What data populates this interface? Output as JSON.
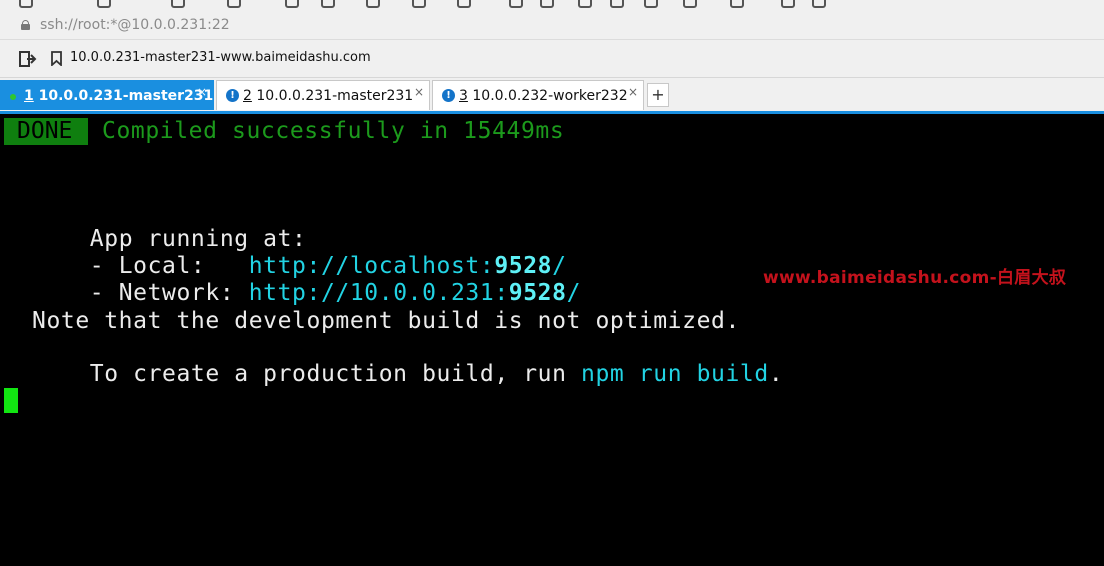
{
  "address_bar": {
    "url": "ssh://root:*@10.0.0.231:22"
  },
  "links_bar": {
    "link": "10.0.0.231-master231-www.baimeidashu.com"
  },
  "tabs": [
    {
      "number": "1",
      "label": "10.0.0.231-master231",
      "close": "×",
      "active": true,
      "status": "connected"
    },
    {
      "number": "2",
      "label": "10.0.0.231-master231",
      "close": "×",
      "active": false,
      "status": "alert"
    },
    {
      "number": "3",
      "label": "10.0.0.232-worker232",
      "close": "×",
      "active": false,
      "status": "alert"
    }
  ],
  "add_tab_label": "+",
  "terminal": {
    "done_badge": "DONE",
    "compiled_message": "Compiled successfully in 15449ms",
    "app_running": "App running at:",
    "local_prefix": "- Local:   ",
    "local_url": "http://localhost:",
    "local_port": "9528",
    "local_slash": "/",
    "network_prefix": "- Network: ",
    "network_url": "http://10.0.0.231:",
    "network_port": "9528",
    "network_slash": "/",
    "note_line": "Note that the development build is not optimized.",
    "create_prefix": "To create a production build, run ",
    "create_command": "npm run build",
    "create_suffix": "."
  },
  "watermark": "www.baimeidashu.com-白眉大叔",
  "colors": {
    "tab_active": "#1a8fe0",
    "done_bg": "#0f7f0f",
    "success_text": "#1c9a1c",
    "url_cyan": "#22d3e3",
    "watermark_red": "#c4121c",
    "cursor_green": "#12e612"
  }
}
